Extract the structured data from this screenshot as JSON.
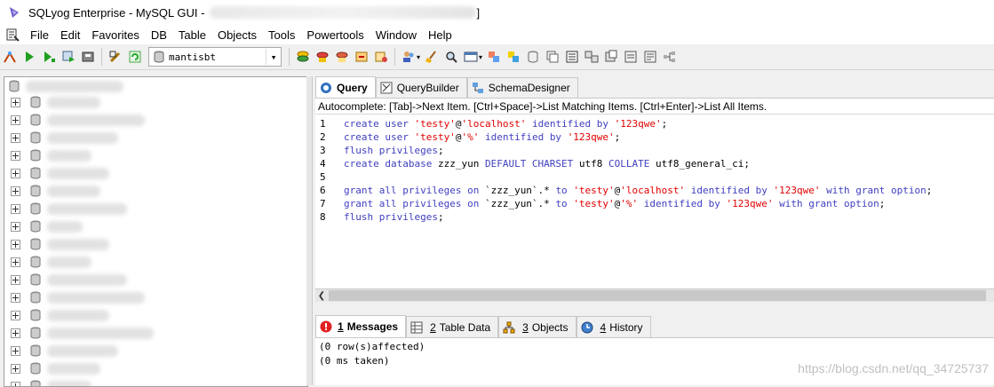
{
  "window": {
    "title": "SQLyog Enterprise - MySQL GUI -",
    "title_end": "]"
  },
  "menu": [
    "File",
    "Edit",
    "Favorites",
    "DB",
    "Table",
    "Objects",
    "Tools",
    "Powertools",
    "Window",
    "Help"
  ],
  "toolbar": {
    "database": "mantisbt"
  },
  "tabs_top": [
    {
      "label": "Query",
      "icon": "query-icon",
      "active": true
    },
    {
      "label": "QueryBuilder",
      "icon": "querybuilder-icon",
      "active": false
    },
    {
      "label": "SchemaDesigner",
      "icon": "schemadesigner-icon",
      "active": false
    }
  ],
  "autocomplete_hint": "Autocomplete: [Tab]->Next Item. [Ctrl+Space]->List Matching Items. [Ctrl+Enter]->List All Items.",
  "editor": {
    "lines": [
      {
        "n": "1",
        "tokens": [
          [
            "kw",
            "create user "
          ],
          [
            "str",
            "'testy'"
          ],
          [
            "plain",
            "@"
          ],
          [
            "str",
            "'localhost'"
          ],
          [
            "kw",
            " identified by "
          ],
          [
            "str",
            "'123qwe'"
          ],
          [
            "plain",
            ";"
          ]
        ]
      },
      {
        "n": "2",
        "tokens": [
          [
            "kw",
            "create user "
          ],
          [
            "str",
            "'testy'"
          ],
          [
            "plain",
            "@"
          ],
          [
            "str",
            "'%'"
          ],
          [
            "kw",
            " identified by "
          ],
          [
            "str",
            "'123qwe'"
          ],
          [
            "plain",
            ";"
          ]
        ]
      },
      {
        "n": "3",
        "tokens": [
          [
            "kw",
            "flush privileges"
          ],
          [
            "plain",
            ";"
          ]
        ]
      },
      {
        "n": "4",
        "tokens": [
          [
            "kw",
            "create database "
          ],
          [
            "plain",
            "zzz_yun "
          ],
          [
            "kw",
            "DEFAULT CHARSET "
          ],
          [
            "plain",
            "utf8 "
          ],
          [
            "kw",
            "COLLATE "
          ],
          [
            "plain",
            "utf8_general_ci;"
          ]
        ]
      },
      {
        "n": "5",
        "tokens": []
      },
      {
        "n": "6",
        "tokens": [
          [
            "kw",
            "grant all privileges on "
          ],
          [
            "plain",
            "`zzz_yun`.* "
          ],
          [
            "kw",
            "to "
          ],
          [
            "str",
            "'testy'"
          ],
          [
            "plain",
            "@"
          ],
          [
            "str",
            "'localhost'"
          ],
          [
            "kw",
            " identified by "
          ],
          [
            "str",
            "'123qwe'"
          ],
          [
            "kw",
            " with grant option"
          ],
          [
            "plain",
            ";"
          ]
        ]
      },
      {
        "n": "7",
        "tokens": [
          [
            "kw",
            "grant all privileges on "
          ],
          [
            "plain",
            "`zzz_yun`.* "
          ],
          [
            "kw",
            "to "
          ],
          [
            "str",
            "'testy'"
          ],
          [
            "plain",
            "@"
          ],
          [
            "str",
            "'%'"
          ],
          [
            "kw",
            " identified by "
          ],
          [
            "str",
            "'123qwe'"
          ],
          [
            "kw",
            " with grant option"
          ],
          [
            "plain",
            ";"
          ]
        ]
      },
      {
        "n": "8",
        "tokens": [
          [
            "kw",
            "flush privileges"
          ],
          [
            "plain",
            ";"
          ]
        ]
      }
    ]
  },
  "tabs_bottom": [
    {
      "num": "1",
      "label": "Messages",
      "active": true
    },
    {
      "num": "2",
      "label": "Table Data",
      "active": false
    },
    {
      "num": "3",
      "label": "Objects",
      "active": false
    },
    {
      "num": "4",
      "label": "History",
      "active": false
    }
  ],
  "messages": [
    "(0 row(s)affected)",
    "(0 ms taken)"
  ],
  "watermark": "https://blog.csdn.net/qq_34725737",
  "colors": {
    "keyword": "#4040c0",
    "string": "#e00000",
    "accent": "#f0a000"
  }
}
